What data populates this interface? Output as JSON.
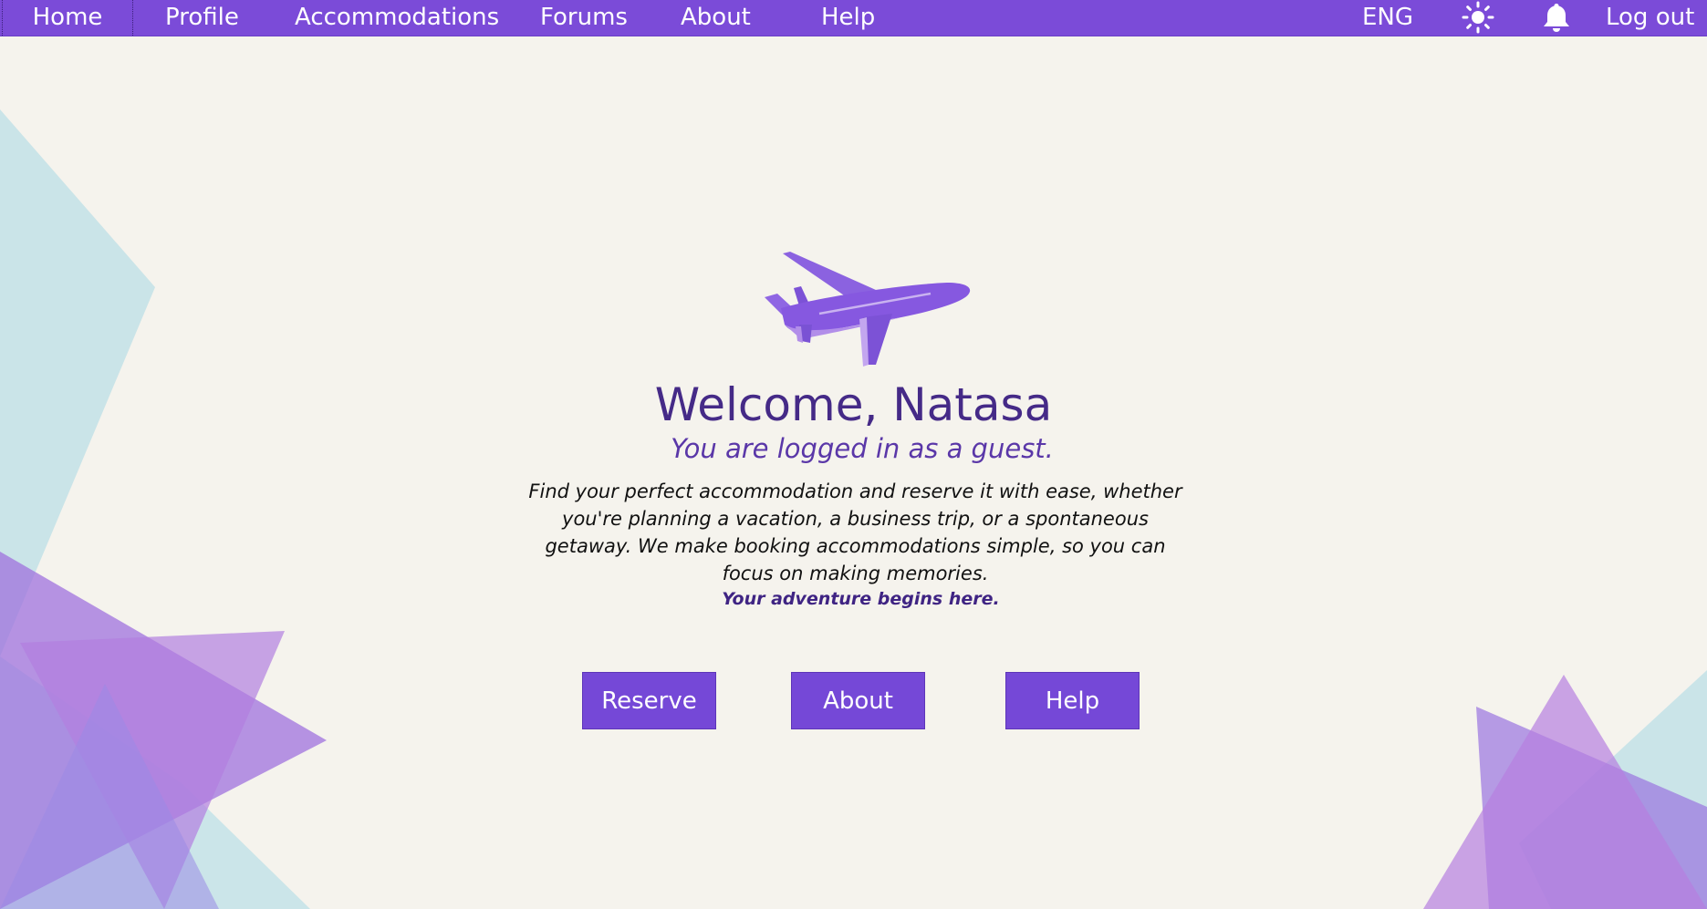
{
  "nav": {
    "items": [
      {
        "label": "Home"
      },
      {
        "label": "Profile"
      },
      {
        "label": "Accommodations"
      },
      {
        "label": "Forums"
      },
      {
        "label": "About"
      },
      {
        "label": "Help"
      }
    ],
    "language": "ENG",
    "theme_icon": "sun-icon",
    "notification_icon": "bell-icon",
    "logout_label": "Log out"
  },
  "hero": {
    "illustration": "airplane-icon",
    "title": "Welcome, Natasa",
    "subtitle": "You are logged in as a guest.",
    "description": "Find your perfect accommodation and reserve it with ease, whether you're planning a vacation, a business trip, or a spontaneous getaway. We make booking accommodations simple, so you can focus on making memories.",
    "tagline": "Your adventure begins here."
  },
  "buttons": {
    "reserve": "Reserve",
    "about": "About",
    "help": "Help"
  },
  "colors": {
    "primary": "#7b4bd8",
    "background": "#f5f3ed",
    "heading": "#452a87",
    "accent_teal": "#b9dfe6",
    "accent_lilac": "#b98ae0"
  }
}
